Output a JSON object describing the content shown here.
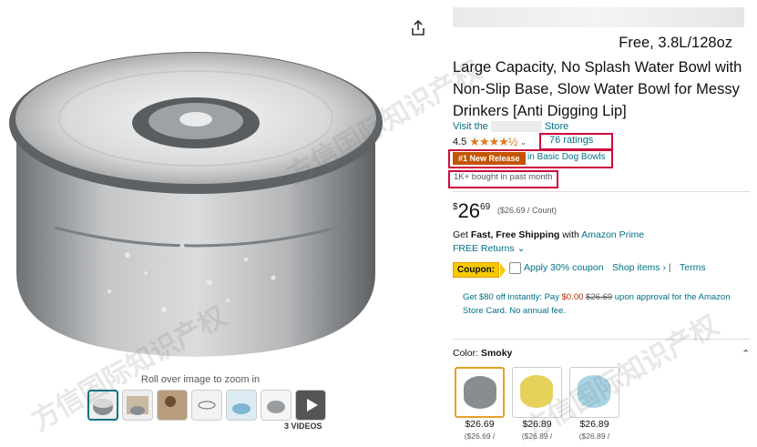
{
  "product": {
    "title_tail": "Free, 3.8L/128oz",
    "title": "Large Capacity, No Splash Water Bowl with Non-Slip Base, Slow Water Bowl for Messy Drinkers [Anti Digging Lip]",
    "visit_prefix": "Visit the",
    "visit_suffix": "Store",
    "rating_value": "4.5",
    "stars": "★★★★½",
    "ratings_count": "76 ratings",
    "badge": "#1 New Release",
    "badge_category": "in Basic Dog Bowls",
    "bought": "1K+ bought in past month"
  },
  "price": {
    "symbol": "$",
    "whole": "26",
    "fraction": "69",
    "unit": "($26.69 / Count)"
  },
  "shipping": {
    "prefix": "Get",
    "bold": "Fast, Free Shipping",
    "mid": "with",
    "link": "Amazon Prime",
    "returns": "FREE Returns ⌄"
  },
  "coupon": {
    "tag": "Coupon:",
    "text": "Apply 30% coupon",
    "shop": "Shop items ›",
    "sep": "|",
    "terms": "Terms"
  },
  "card_offer": {
    "part1": "Get $80 off instantly: Pay",
    "pay": "$0.00",
    "strike": "$26.69",
    "part2": "upon approval for the Amazon Store Card. No annual fee."
  },
  "color": {
    "label": "Color:",
    "value": "Smoky"
  },
  "swatches": [
    {
      "price": "$26.69",
      "sub": "($26.69 /",
      "color": "#8a8d90"
    },
    {
      "price": "$26.89",
      "sub": "($26.89 /",
      "color": "#e6d25a"
    },
    {
      "price": "$26.89",
      "sub": "($26.89 /",
      "color": "#a8d4e6"
    }
  ],
  "gallery": {
    "hint": "Roll over image to zoom in",
    "videos": "3 VIDEOS"
  },
  "watermark": "方信国际知识产权",
  "icons": {
    "share": "share-icon",
    "chevron": "chevron-down-icon",
    "collapse": "chevron-up-icon"
  }
}
